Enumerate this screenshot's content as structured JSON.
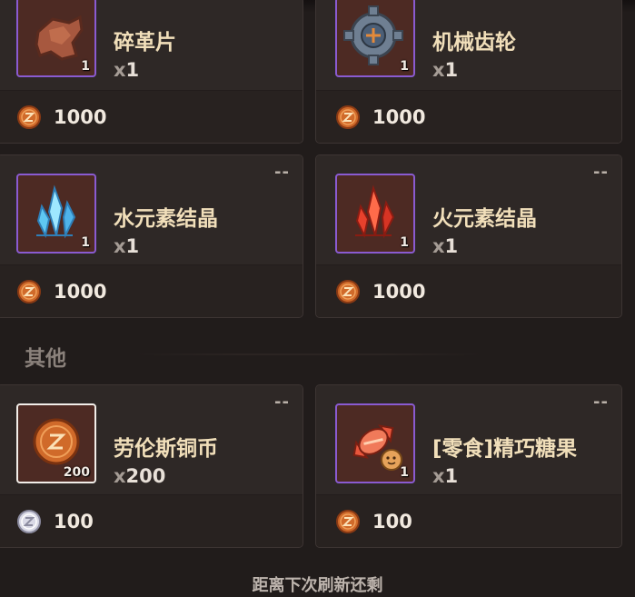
{
  "colors": {
    "background": "#211c1b",
    "card": "#2e2826",
    "slot_border_purple": "#8a5bd1",
    "slot_border_white": "#f2eee9",
    "name_text": "#f1dfba",
    "copper_coin": "#d06a2a",
    "silver_coin": "#d9d9e6"
  },
  "shop": {
    "items": [
      {
        "name": "碎革片",
        "icon": "leather-scrap-icon",
        "slot_qty": "1",
        "count_prefix": "x",
        "count": "1",
        "price_currency": "copper-coin-icon",
        "price": "1000",
        "badge": ""
      },
      {
        "name": "机械齿轮",
        "icon": "gear-icon",
        "slot_qty": "1",
        "count_prefix": "x",
        "count": "1",
        "price_currency": "copper-coin-icon",
        "price": "1000",
        "badge": ""
      },
      {
        "name": "水元素结晶",
        "icon": "water-crystal-icon",
        "slot_qty": "1",
        "count_prefix": "x",
        "count": "1",
        "price_currency": "copper-coin-icon",
        "price": "1000",
        "badge": "--"
      },
      {
        "name": "火元素结晶",
        "icon": "fire-crystal-icon",
        "slot_qty": "1",
        "count_prefix": "x",
        "count": "1",
        "price_currency": "copper-coin-icon",
        "price": "1000",
        "badge": "--"
      }
    ],
    "other_section_title": "其他",
    "other_items": [
      {
        "name": "劳伦斯铜币",
        "icon": "lawrence-copper-coin-icon",
        "slot_qty": "200",
        "count_prefix": "x",
        "count": "200",
        "price_currency": "silver-coin-icon",
        "price": "100",
        "badge": "--"
      },
      {
        "name": "[零食]精巧糖果",
        "icon": "candy-icon",
        "slot_qty": "1",
        "count_prefix": "x",
        "count": "1",
        "price_currency": "copper-coin-icon",
        "price": "100",
        "badge": "--"
      }
    ]
  },
  "footer": {
    "refresh_text": "距离下次刷新还剩"
  }
}
